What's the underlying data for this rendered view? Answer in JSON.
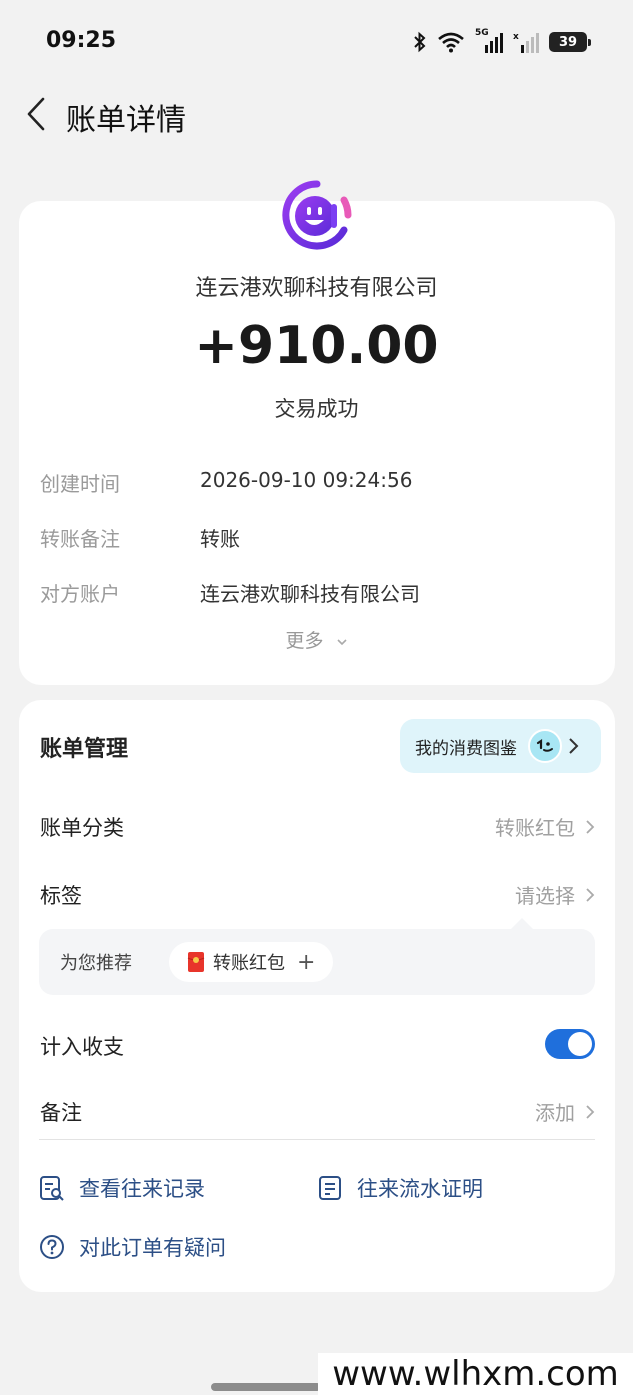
{
  "status_bar": {
    "time": "09:25",
    "network_label": "5G",
    "battery": "39"
  },
  "nav": {
    "title": "账单详情"
  },
  "transaction": {
    "merchant_name": "连云港欢聊科技有限公司",
    "amount": "+910.00",
    "status": "交易成功",
    "details": [
      {
        "label": "创建时间",
        "value": "2026-09-10 09:24:56"
      },
      {
        "label": "转账备注",
        "value": "转账"
      },
      {
        "label": "对方账户",
        "value": "连云港欢聊科技有限公司"
      }
    ],
    "more_label": "更多"
  },
  "management": {
    "title": "账单管理",
    "spend_pill_label": "我的消费图鉴",
    "category": {
      "label": "账单分类",
      "value": "转账红包"
    },
    "tag": {
      "label": "标签",
      "value": "请选择"
    },
    "recommend": {
      "label": "为您推荐",
      "chip_label": "转账红包"
    },
    "count_in": {
      "label": "计入收支",
      "enabled": true
    },
    "note": {
      "label": "备注",
      "value": "添加"
    },
    "links": {
      "history": "查看往来记录",
      "proof": "往来流水证明",
      "question": "对此订单有疑问"
    }
  },
  "watermark": "www.wlhxm.com",
  "colors": {
    "accent_blue": "#1f6fdc",
    "link_blue": "#2c4f86",
    "logo_purple": "#7b3ff2",
    "pill_bg": "#dff4fa"
  }
}
